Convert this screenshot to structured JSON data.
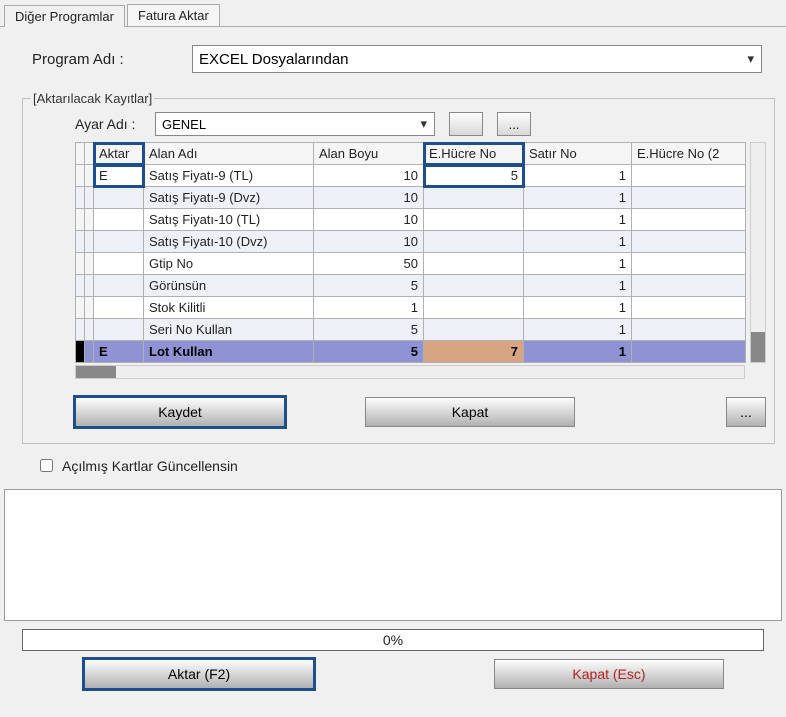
{
  "tabs": {
    "other": "Diğer Programlar",
    "invoice": "Fatura Aktar"
  },
  "program": {
    "label": "Program Adı :",
    "value": "EXCEL Dosyalarından"
  },
  "records": {
    "legend": "[Aktarılacak Kayıtlar]",
    "ayar_label": "Ayar Adı :",
    "ayar_value": "GENEL",
    "cols": {
      "aktar": "Aktar",
      "alan": "Alan Adı",
      "boy": "Alan Boyu",
      "hucre": "E.Hücre No",
      "satir": "Satır No",
      "hucre2": "E.Hücre No (2"
    },
    "rows": [
      {
        "aktar": "E",
        "alan": "Satış Fiyatı-9 (TL)",
        "boy": "10",
        "hucre": "5",
        "satir": "1"
      },
      {
        "aktar": "",
        "alan": "Satış Fiyatı-9 (Dvz)",
        "boy": "10",
        "hucre": "",
        "satir": "1"
      },
      {
        "aktar": "",
        "alan": "Satış Fiyatı-10 (TL)",
        "boy": "10",
        "hucre": "",
        "satir": "1"
      },
      {
        "aktar": "",
        "alan": "Satış Fiyatı-10 (Dvz)",
        "boy": "10",
        "hucre": "",
        "satir": "1"
      },
      {
        "aktar": "",
        "alan": "Gtip No",
        "boy": "50",
        "hucre": "",
        "satir": "1"
      },
      {
        "aktar": "",
        "alan": "Görünsün",
        "boy": "5",
        "hucre": "",
        "satir": "1"
      },
      {
        "aktar": "",
        "alan": "Stok Kilitli",
        "boy": "1",
        "hucre": "",
        "satir": "1"
      },
      {
        "aktar": "",
        "alan": "Seri No Kullan",
        "boy": "5",
        "hucre": "",
        "satir": "1"
      },
      {
        "aktar": "E",
        "alan": "Lot Kullan",
        "boy": "5",
        "hucre": "7",
        "satir": "1"
      }
    ],
    "save": "Kaydet",
    "close": "Kapat",
    "more": "..."
  },
  "update_check": "Açılmış Kartlar Güncellensin",
  "progress": "0%",
  "transfer": "Aktar (F2)",
  "close_esc": "Kapat (Esc)"
}
